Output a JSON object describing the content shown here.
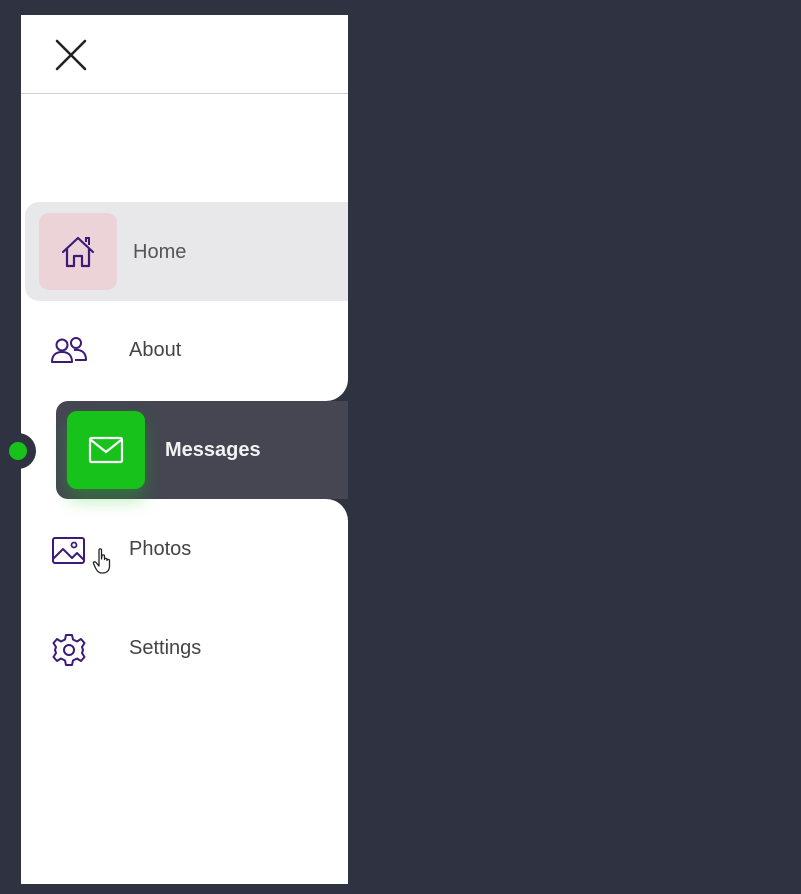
{
  "close_icon": "close-icon",
  "nav": {
    "items": [
      {
        "label": "Home",
        "icon": "home-icon",
        "state": "hover"
      },
      {
        "label": "About",
        "icon": "people-icon",
        "state": "normal"
      },
      {
        "label": "Messages",
        "icon": "mail-icon",
        "state": "active"
      },
      {
        "label": "Photos",
        "icon": "image-icon",
        "state": "normal"
      },
      {
        "label": "Settings",
        "icon": "gear-icon",
        "state": "normal"
      }
    ]
  },
  "colors": {
    "page_background": "#2f3240",
    "sidebar_background": "#ffffff",
    "active_item_background": "#454652",
    "active_accent": "#17c21a",
    "hover_tile": "#ecd3d8",
    "hover_row": "#e8e8ea",
    "icon_color": "#3d1a78"
  }
}
